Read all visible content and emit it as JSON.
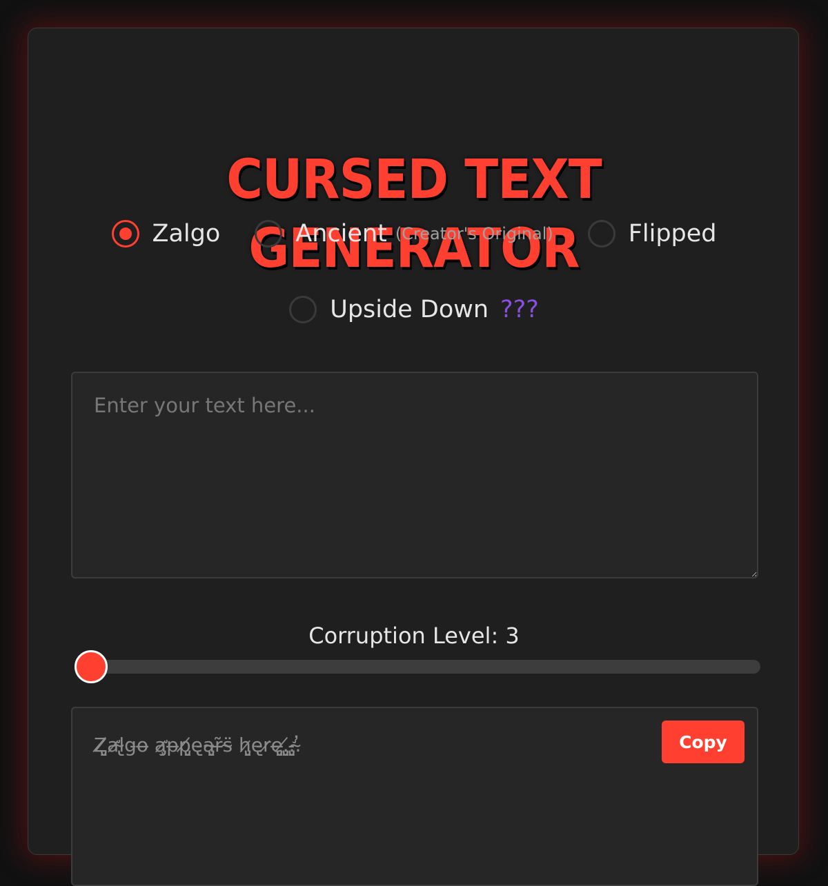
{
  "title": "Cursed Text Generator",
  "modes": [
    {
      "label": "Zalgo",
      "sub": "",
      "checked": true
    },
    {
      "label": "Ancient",
      "sub": "(Creator's Original)",
      "checked": false
    },
    {
      "label": "Flipped",
      "sub": "",
      "checked": false
    },
    {
      "label": "Upside Down",
      "sub": "",
      "checked": false
    }
  ],
  "mystery_label": "???",
  "input": {
    "placeholder": "Enter your text here...",
    "value": ""
  },
  "corruption": {
    "label": "Corruption Level: 3",
    "value": 3,
    "min": 3,
    "max": 100
  },
  "output": {
    "text": "Z̸̡̢a̷̛l̴̢g̵o̶ a̷̡̧̛p̶p̸̡̢e̵̢a̴̡̢r̶̃s̴̈ h̷̡̢e̵̢r̷e̶̡̢.̸̡̢.̵̢̡̛.̴̓",
    "copy_label": "Copy"
  },
  "colors": {
    "accent": "#ff4030",
    "mystery": "#8b4fe0",
    "card_bg": "#1f1f20",
    "page_bg": "#111112"
  }
}
